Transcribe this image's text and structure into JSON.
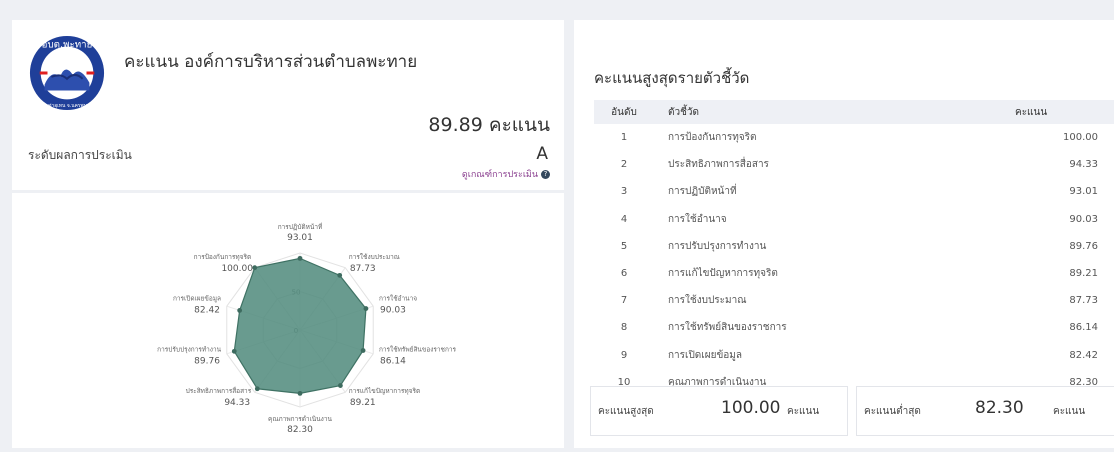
{
  "header": {
    "title": "คะแนน องค์การบริหารส่วนตำบลพะทาย",
    "score_text": "89.89 คะแนน",
    "level_label": "ระดับผลการประเมิน",
    "grade": "A",
    "criteria_link": "ดูเกณฑ์การประเมิน"
  },
  "logo": {
    "top_text": "อบต.พะทาย",
    "bottom_text": "อ.ท่าอุเทน จ.นครพนม"
  },
  "chart_data": {
    "type": "radar",
    "rmax": 100,
    "ring_labels": [
      "50",
      "0"
    ],
    "axes": [
      {
        "label": "การปฏิบัติหน้าที่",
        "value": 93.01,
        "value_text": "93.01"
      },
      {
        "label": "การใช้งบประมาณ",
        "value": 87.73,
        "value_text": "87.73"
      },
      {
        "label": "การใช้อำนาจ",
        "value": 90.03,
        "value_text": "90.03"
      },
      {
        "label": "การใช้ทรัพย์สินของราชการ",
        "value": 86.14,
        "value_text": "86.14"
      },
      {
        "label": "การแก้ไขปัญหาการทุจริต",
        "value": 89.21,
        "value_text": "89.21"
      },
      {
        "label": "คุณภาพการดำเนินงาน",
        "value": 82.3,
        "value_text": "82.30"
      },
      {
        "label": "ประสิทธิภาพการสื่อสาร",
        "value": 94.33,
        "value_text": "94.33"
      },
      {
        "label": "การปรับปรุงการทำงาน",
        "value": 89.76,
        "value_text": "89.76"
      },
      {
        "label": "การเปิดเผยข้อมูล",
        "value": 82.42,
        "value_text": "82.42"
      },
      {
        "label": "การป้องกันการทุจริต",
        "value": 100.0,
        "value_text": "100.00"
      }
    ]
  },
  "ranking": {
    "title": "คะแนนสูงสุดรายตัวชี้วัด",
    "headers": {
      "rank": "อันดับ",
      "indicator": "ตัวชี้วัด",
      "score": "คะแนน"
    },
    "rows": [
      {
        "rank": "1",
        "name": "การป้องกันการทุจริต",
        "score": "100.00"
      },
      {
        "rank": "2",
        "name": "ประสิทธิภาพการสื่อสาร",
        "score": "94.33"
      },
      {
        "rank": "3",
        "name": "การปฏิบัติหน้าที่",
        "score": "93.01"
      },
      {
        "rank": "4",
        "name": "การใช้อำนาจ",
        "score": "90.03"
      },
      {
        "rank": "5",
        "name": "การปรับปรุงการทำงาน",
        "score": "89.76"
      },
      {
        "rank": "6",
        "name": "การแก้ไขปัญหาการทุจริต",
        "score": "89.21"
      },
      {
        "rank": "7",
        "name": "การใช้งบประมาณ",
        "score": "87.73"
      },
      {
        "rank": "8",
        "name": "การใช้ทรัพย์สินของราชการ",
        "score": "86.14"
      },
      {
        "rank": "9",
        "name": "การเปิดเผยข้อมูล",
        "score": "82.42"
      },
      {
        "rank": "10",
        "name": "คุณภาพการดำเนินงาน",
        "score": "82.30"
      }
    ]
  },
  "summary": {
    "max_label": "คะแนนสูงสุด",
    "max_value": "100.00",
    "min_label": "คะแนนต่ำสุด",
    "min_value": "82.30",
    "unit": "คะแนน"
  },
  "colors": {
    "radar_fill": "#4f8a7b",
    "radar_stroke": "#3f7264",
    "radar_point": "#3d6b5f",
    "link": "#8a3f8f"
  }
}
